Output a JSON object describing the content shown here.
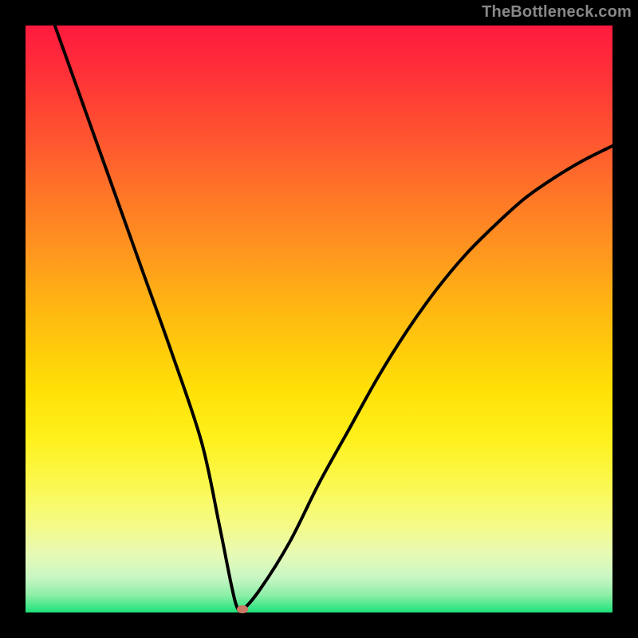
{
  "watermark": "TheBottleneck.com",
  "chart_data": {
    "type": "line",
    "title": "",
    "xlabel": "",
    "ylabel": "",
    "xlim": [
      0,
      100
    ],
    "ylim": [
      0,
      100
    ],
    "grid": false,
    "legend": false,
    "series": [
      {
        "name": "bottleneck-curve",
        "x": [
          5,
          10,
          15,
          20,
          25,
          30,
          33,
          35,
          36,
          37,
          40,
          45,
          50,
          55,
          60,
          65,
          70,
          75,
          80,
          85,
          90,
          95,
          100
        ],
        "values": [
          100,
          86,
          72,
          58,
          44,
          29,
          15,
          5,
          1,
          0.5,
          4,
          12,
          22,
          31,
          40,
          48,
          55,
          61,
          66,
          70.5,
          74,
          77,
          79.5
        ]
      }
    ],
    "marker": {
      "x": 37,
      "y": 0.5
    },
    "gradient_stops": [
      {
        "pos": 0,
        "color": "#ff1a3f"
      },
      {
        "pos": 50,
        "color": "#ffd000"
      },
      {
        "pos": 80,
        "color": "#fbf84e"
      },
      {
        "pos": 100,
        "color": "#1de27a"
      }
    ]
  }
}
